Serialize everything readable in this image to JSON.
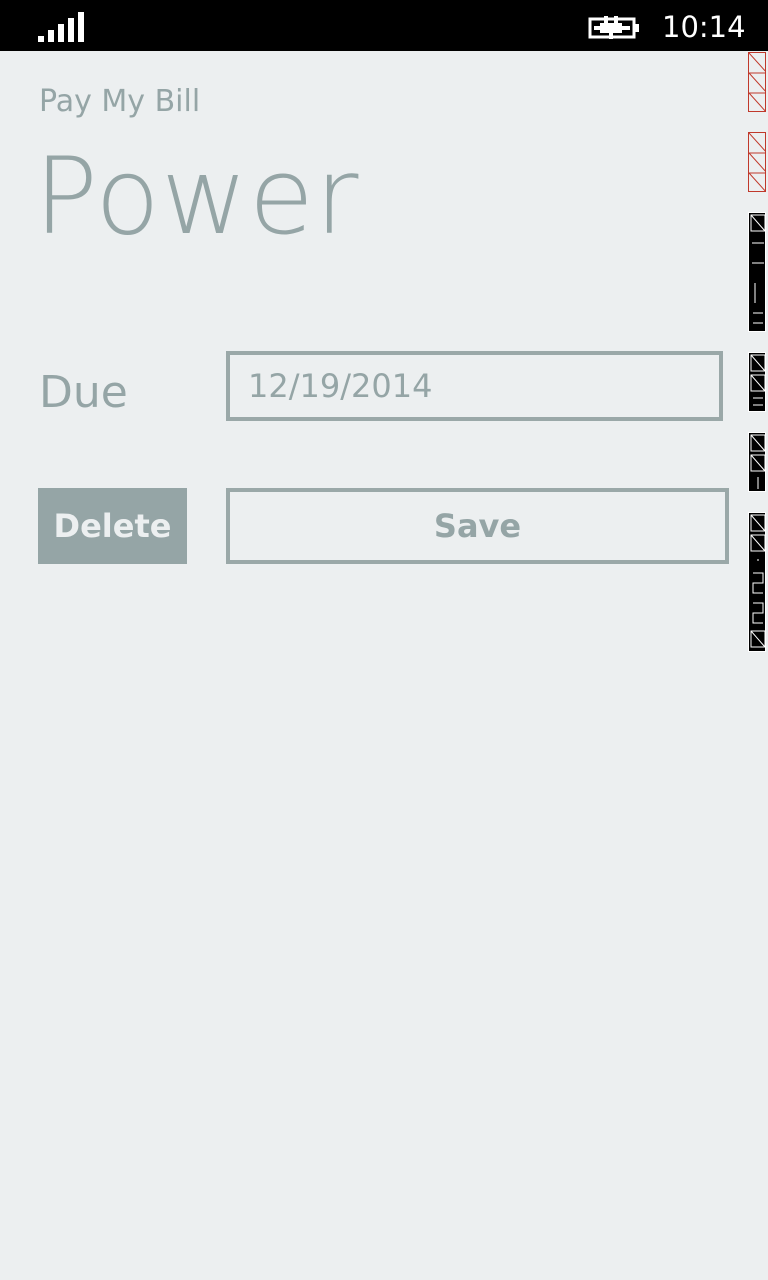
{
  "status_bar": {
    "time": "10:14",
    "signal_icon": "signal-strength-icon",
    "battery_icon": "battery-charging-icon"
  },
  "app": {
    "title": "Pay My Bill",
    "page_title": "Power"
  },
  "form": {
    "due_label": "Due",
    "due_value": "12/19/2014"
  },
  "actions": {
    "delete_label": "Delete",
    "save_label": "Save"
  },
  "colors": {
    "background": "#eceff0",
    "accent": "#95a5a6",
    "status_bar": "#000000",
    "debug_red": "#c0392b"
  }
}
